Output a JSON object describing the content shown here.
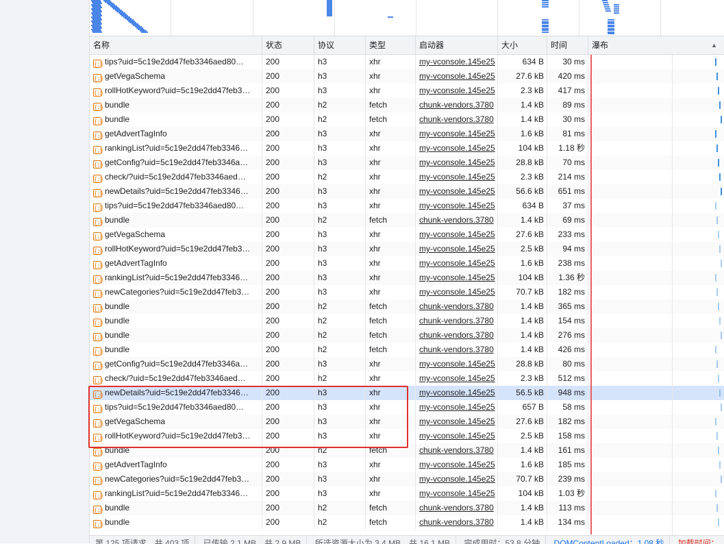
{
  "columns": {
    "name": "名称",
    "status": "状态",
    "protocol": "协议",
    "type": "类型",
    "initiator": "启动器",
    "size": "大小",
    "time": "时间",
    "waterfall": "瀑布"
  },
  "sort_indicator": "▲",
  "rows": [
    {
      "name": "tips?uid=5c19e2dd47feb3346aed80…",
      "status": "200",
      "protocol": "h3",
      "type": "xhr",
      "initiator": "my-vconsole.145e25",
      "size": "634 B",
      "time": "30 ms"
    },
    {
      "name": "getVegaSchema",
      "status": "200",
      "protocol": "h3",
      "type": "xhr",
      "initiator": "my-vconsole.145e25",
      "size": "27.6 kB",
      "time": "420 ms"
    },
    {
      "name": "rollHotKeyword?uid=5c19e2dd47feb3…",
      "status": "200",
      "protocol": "h3",
      "type": "xhr",
      "initiator": "my-vconsole.145e25",
      "size": "2.3 kB",
      "time": "417 ms"
    },
    {
      "name": "bundle",
      "status": "200",
      "protocol": "h2",
      "type": "fetch",
      "initiator": "chunk-vendors.3780",
      "size": "1.4 kB",
      "time": "89 ms"
    },
    {
      "name": "bundle",
      "status": "200",
      "protocol": "h2",
      "type": "fetch",
      "initiator": "chunk-vendors.3780",
      "size": "1.4 kB",
      "time": "30 ms"
    },
    {
      "name": "getAdvertTagInfo",
      "status": "200",
      "protocol": "h3",
      "type": "xhr",
      "initiator": "my-vconsole.145e25",
      "size": "1.6 kB",
      "time": "81 ms"
    },
    {
      "name": "rankingList?uid=5c19e2dd47feb3346…",
      "status": "200",
      "protocol": "h3",
      "type": "xhr",
      "initiator": "my-vconsole.145e25",
      "size": "104 kB",
      "time": "1.18 秒"
    },
    {
      "name": "getConfig?uid=5c19e2dd47feb3346a…",
      "status": "200",
      "protocol": "h3",
      "type": "xhr",
      "initiator": "my-vconsole.145e25",
      "size": "28.8 kB",
      "time": "70 ms"
    },
    {
      "name": "check/?uid=5c19e2dd47feb3346aed…",
      "status": "200",
      "protocol": "h2",
      "type": "xhr",
      "initiator": "my-vconsole.145e25",
      "size": "2.3 kB",
      "time": "214 ms"
    },
    {
      "name": "newDetails?uid=5c19e2dd47feb3346…",
      "status": "200",
      "protocol": "h3",
      "type": "xhr",
      "initiator": "my-vconsole.145e25",
      "size": "56.6 kB",
      "time": "651 ms"
    },
    {
      "name": "tips?uid=5c19e2dd47feb3346aed80…",
      "status": "200",
      "protocol": "h3",
      "type": "xhr",
      "initiator": "my-vconsole.145e25",
      "size": "634 B",
      "time": "37 ms"
    },
    {
      "name": "bundle",
      "status": "200",
      "protocol": "h2",
      "type": "fetch",
      "initiator": "chunk-vendors.3780",
      "size": "1.4 kB",
      "time": "69 ms"
    },
    {
      "name": "getVegaSchema",
      "status": "200",
      "protocol": "h3",
      "type": "xhr",
      "initiator": "my-vconsole.145e25",
      "size": "27.6 kB",
      "time": "233 ms"
    },
    {
      "name": "rollHotKeyword?uid=5c19e2dd47feb3…",
      "status": "200",
      "protocol": "h3",
      "type": "xhr",
      "initiator": "my-vconsole.145e25",
      "size": "2.5 kB",
      "time": "94 ms"
    },
    {
      "name": "getAdvertTagInfo",
      "status": "200",
      "protocol": "h3",
      "type": "xhr",
      "initiator": "my-vconsole.145e25",
      "size": "1.6 kB",
      "time": "238 ms"
    },
    {
      "name": "rankingList?uid=5c19e2dd47feb3346…",
      "status": "200",
      "protocol": "h3",
      "type": "xhr",
      "initiator": "my-vconsole.145e25",
      "size": "104 kB",
      "time": "1.36 秒"
    },
    {
      "name": "newCategories?uid=5c19e2dd47feb3…",
      "status": "200",
      "protocol": "h3",
      "type": "xhr",
      "initiator": "my-vconsole.145e25",
      "size": "70.7 kB",
      "time": "182 ms"
    },
    {
      "name": "bundle",
      "status": "200",
      "protocol": "h2",
      "type": "fetch",
      "initiator": "chunk-vendors.3780",
      "size": "1.4 kB",
      "time": "365 ms"
    },
    {
      "name": "bundle",
      "status": "200",
      "protocol": "h2",
      "type": "fetch",
      "initiator": "chunk-vendors.3780",
      "size": "1.4 kB",
      "time": "154 ms"
    },
    {
      "name": "bundle",
      "status": "200",
      "protocol": "h2",
      "type": "fetch",
      "initiator": "chunk-vendors.3780",
      "size": "1.4 kB",
      "time": "276 ms"
    },
    {
      "name": "bundle",
      "status": "200",
      "protocol": "h2",
      "type": "fetch",
      "initiator": "chunk-vendors.3780",
      "size": "1.4 kB",
      "time": "426 ms"
    },
    {
      "name": "getConfig?uid=5c19e2dd47feb3346a…",
      "status": "200",
      "protocol": "h3",
      "type": "xhr",
      "initiator": "my-vconsole.145e25",
      "size": "28.8 kB",
      "time": "80 ms"
    },
    {
      "name": "check/?uid=5c19e2dd47feb3346aed…",
      "status": "200",
      "protocol": "h2",
      "type": "xhr",
      "initiator": "my-vconsole.145e25",
      "size": "2.3 kB",
      "time": "512 ms"
    },
    {
      "name": "newDetails?uid=5c19e2dd47feb3346…",
      "status": "200",
      "protocol": "h3",
      "type": "xhr",
      "initiator": "my-vconsole.145e25",
      "size": "56.5 kB",
      "time": "948 ms",
      "selected": true
    },
    {
      "name": "tips?uid=5c19e2dd47feb3346aed80…",
      "status": "200",
      "protocol": "h3",
      "type": "xhr",
      "initiator": "my-vconsole.145e25",
      "size": "657 B",
      "time": "58 ms"
    },
    {
      "name": "getVegaSchema",
      "status": "200",
      "protocol": "h3",
      "type": "xhr",
      "initiator": "my-vconsole.145e25",
      "size": "27.6 kB",
      "time": "182 ms"
    },
    {
      "name": "rollHotKeyword?uid=5c19e2dd47feb3…",
      "status": "200",
      "protocol": "h3",
      "type": "xhr",
      "initiator": "my-vconsole.145e25",
      "size": "2.5 kB",
      "time": "158 ms"
    },
    {
      "name": "bundle",
      "status": "200",
      "protocol": "h2",
      "type": "fetch",
      "initiator": "chunk-vendors.3780",
      "size": "1.4 kB",
      "time": "161 ms"
    },
    {
      "name": "getAdvertTagInfo",
      "status": "200",
      "protocol": "h3",
      "type": "xhr",
      "initiator": "my-vconsole.145e25",
      "size": "1.6 kB",
      "time": "185 ms"
    },
    {
      "name": "newCategories?uid=5c19e2dd47feb3…",
      "status": "200",
      "protocol": "h3",
      "type": "xhr",
      "initiator": "my-vconsole.145e25",
      "size": "70.7 kB",
      "time": "239 ms"
    },
    {
      "name": "rankingList?uid=5c19e2dd47feb3346…",
      "status": "200",
      "protocol": "h3",
      "type": "xhr",
      "initiator": "my-vconsole.145e25",
      "size": "104 kB",
      "time": "1.03 秒"
    },
    {
      "name": "bundle",
      "status": "200",
      "protocol": "h2",
      "type": "fetch",
      "initiator": "chunk-vendors.3780",
      "size": "1.4 kB",
      "time": "113 ms"
    },
    {
      "name": "bundle",
      "status": "200",
      "protocol": "h2",
      "type": "fetch",
      "initiator": "chunk-vendors.3780",
      "size": "1.4 kB",
      "time": "134 ms"
    }
  ],
  "row_icon": "{;}",
  "statusbar": {
    "requests": "第 125 项请求，共 403 项",
    "transferred": "已传输 2.1 MB，共 2.9 MB",
    "resources": "所选资源大小为 3.4 MB，共 16.1 MB",
    "finish": "完成用时：53.8 分钟",
    "domcontentloaded": "DOMContentLoaded：1.08 秒",
    "load": "加载时间："
  },
  "colors": {
    "highlight_box": "#e0302c",
    "selected_row": "#d6e4fb",
    "waterfall_bar": "#3c90e0",
    "load_line": "#e55e5e"
  }
}
